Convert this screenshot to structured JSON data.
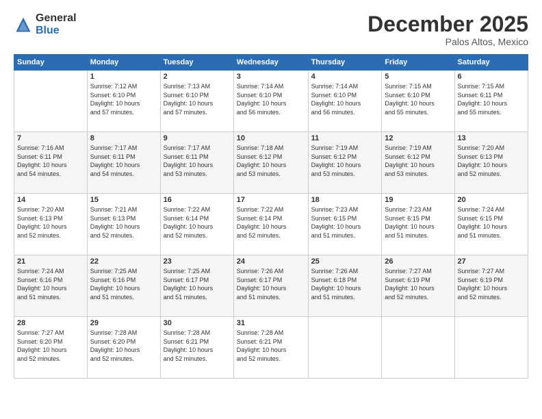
{
  "logo": {
    "general": "General",
    "blue": "Blue"
  },
  "title": "December 2025",
  "location": "Palos Altos, Mexico",
  "days_header": [
    "Sunday",
    "Monday",
    "Tuesday",
    "Wednesday",
    "Thursday",
    "Friday",
    "Saturday"
  ],
  "weeks": [
    [
      {
        "day": "",
        "data": ""
      },
      {
        "day": "1",
        "data": "Sunrise: 7:12 AM\nSunset: 6:10 PM\nDaylight: 10 hours\nand 57 minutes."
      },
      {
        "day": "2",
        "data": "Sunrise: 7:13 AM\nSunset: 6:10 PM\nDaylight: 10 hours\nand 57 minutes."
      },
      {
        "day": "3",
        "data": "Sunrise: 7:14 AM\nSunset: 6:10 PM\nDaylight: 10 hours\nand 56 minutes."
      },
      {
        "day": "4",
        "data": "Sunrise: 7:14 AM\nSunset: 6:10 PM\nDaylight: 10 hours\nand 56 minutes."
      },
      {
        "day": "5",
        "data": "Sunrise: 7:15 AM\nSunset: 6:10 PM\nDaylight: 10 hours\nand 55 minutes."
      },
      {
        "day": "6",
        "data": "Sunrise: 7:15 AM\nSunset: 6:11 PM\nDaylight: 10 hours\nand 55 minutes."
      }
    ],
    [
      {
        "day": "7",
        "data": "Sunrise: 7:16 AM\nSunset: 6:11 PM\nDaylight: 10 hours\nand 54 minutes."
      },
      {
        "day": "8",
        "data": "Sunrise: 7:17 AM\nSunset: 6:11 PM\nDaylight: 10 hours\nand 54 minutes."
      },
      {
        "day": "9",
        "data": "Sunrise: 7:17 AM\nSunset: 6:11 PM\nDaylight: 10 hours\nand 53 minutes."
      },
      {
        "day": "10",
        "data": "Sunrise: 7:18 AM\nSunset: 6:12 PM\nDaylight: 10 hours\nand 53 minutes."
      },
      {
        "day": "11",
        "data": "Sunrise: 7:19 AM\nSunset: 6:12 PM\nDaylight: 10 hours\nand 53 minutes."
      },
      {
        "day": "12",
        "data": "Sunrise: 7:19 AM\nSunset: 6:12 PM\nDaylight: 10 hours\nand 53 minutes."
      },
      {
        "day": "13",
        "data": "Sunrise: 7:20 AM\nSunset: 6:13 PM\nDaylight: 10 hours\nand 52 minutes."
      }
    ],
    [
      {
        "day": "14",
        "data": "Sunrise: 7:20 AM\nSunset: 6:13 PM\nDaylight: 10 hours\nand 52 minutes."
      },
      {
        "day": "15",
        "data": "Sunrise: 7:21 AM\nSunset: 6:13 PM\nDaylight: 10 hours\nand 52 minutes."
      },
      {
        "day": "16",
        "data": "Sunrise: 7:22 AM\nSunset: 6:14 PM\nDaylight: 10 hours\nand 52 minutes."
      },
      {
        "day": "17",
        "data": "Sunrise: 7:22 AM\nSunset: 6:14 PM\nDaylight: 10 hours\nand 52 minutes."
      },
      {
        "day": "18",
        "data": "Sunrise: 7:23 AM\nSunset: 6:15 PM\nDaylight: 10 hours\nand 51 minutes."
      },
      {
        "day": "19",
        "data": "Sunrise: 7:23 AM\nSunset: 6:15 PM\nDaylight: 10 hours\nand 51 minutes."
      },
      {
        "day": "20",
        "data": "Sunrise: 7:24 AM\nSunset: 6:15 PM\nDaylight: 10 hours\nand 51 minutes."
      }
    ],
    [
      {
        "day": "21",
        "data": "Sunrise: 7:24 AM\nSunset: 6:16 PM\nDaylight: 10 hours\nand 51 minutes."
      },
      {
        "day": "22",
        "data": "Sunrise: 7:25 AM\nSunset: 6:16 PM\nDaylight: 10 hours\nand 51 minutes."
      },
      {
        "day": "23",
        "data": "Sunrise: 7:25 AM\nSunset: 6:17 PM\nDaylight: 10 hours\nand 51 minutes."
      },
      {
        "day": "24",
        "data": "Sunrise: 7:26 AM\nSunset: 6:17 PM\nDaylight: 10 hours\nand 51 minutes."
      },
      {
        "day": "25",
        "data": "Sunrise: 7:26 AM\nSunset: 6:18 PM\nDaylight: 10 hours\nand 51 minutes."
      },
      {
        "day": "26",
        "data": "Sunrise: 7:27 AM\nSunset: 6:19 PM\nDaylight: 10 hours\nand 52 minutes."
      },
      {
        "day": "27",
        "data": "Sunrise: 7:27 AM\nSunset: 6:19 PM\nDaylight: 10 hours\nand 52 minutes."
      }
    ],
    [
      {
        "day": "28",
        "data": "Sunrise: 7:27 AM\nSunset: 6:20 PM\nDaylight: 10 hours\nand 52 minutes."
      },
      {
        "day": "29",
        "data": "Sunrise: 7:28 AM\nSunset: 6:20 PM\nDaylight: 10 hours\nand 52 minutes."
      },
      {
        "day": "30",
        "data": "Sunrise: 7:28 AM\nSunset: 6:21 PM\nDaylight: 10 hours\nand 52 minutes."
      },
      {
        "day": "31",
        "data": "Sunrise: 7:28 AM\nSunset: 6:21 PM\nDaylight: 10 hours\nand 52 minutes."
      },
      {
        "day": "",
        "data": ""
      },
      {
        "day": "",
        "data": ""
      },
      {
        "day": "",
        "data": ""
      }
    ]
  ]
}
